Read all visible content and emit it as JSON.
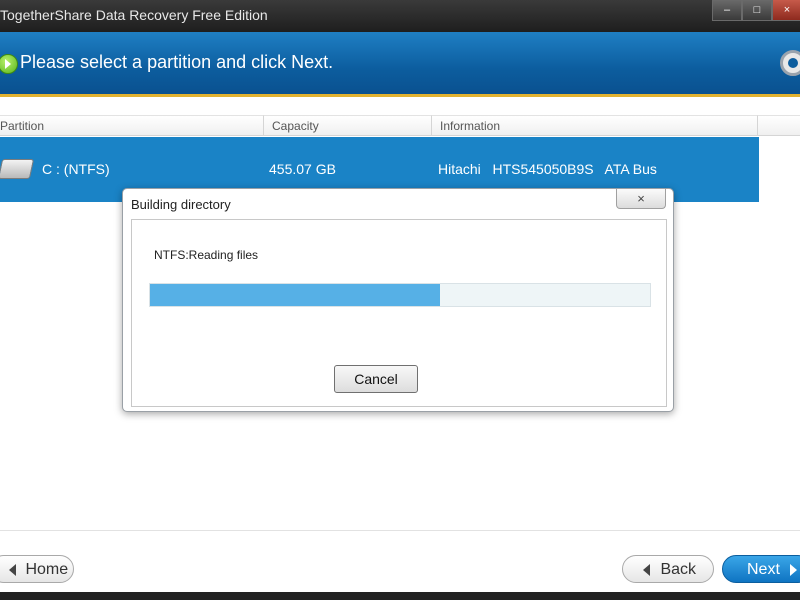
{
  "window": {
    "title": "TogetherShare Data Recovery Free Edition",
    "controls": {
      "minimize": "–",
      "maximize": "□",
      "close": "×"
    }
  },
  "header": {
    "heading": "Please select a partition and click Next.",
    "icons": {
      "go": "go-arrow-icon",
      "settings": "gear-icon"
    },
    "accent": "#e2b230"
  },
  "table": {
    "columns": [
      "Partition",
      "Capacity",
      "Information"
    ],
    "rows": [
      {
        "partition": "C :  (NTFS)",
        "capacity": "455.07 GB",
        "information": "Hitachi   HTS545050B9S   ATA Bus"
      }
    ],
    "selected_color": "#1a83c6"
  },
  "dialog": {
    "title": "Building directory",
    "close_label": "×",
    "status": "NTFS:Reading files",
    "progress": 0.58,
    "progress_color": "#56b0e6",
    "cancel_label": "Cancel"
  },
  "footer": {
    "home_label": "Home",
    "back_label": "Back",
    "next_label": "Next"
  }
}
